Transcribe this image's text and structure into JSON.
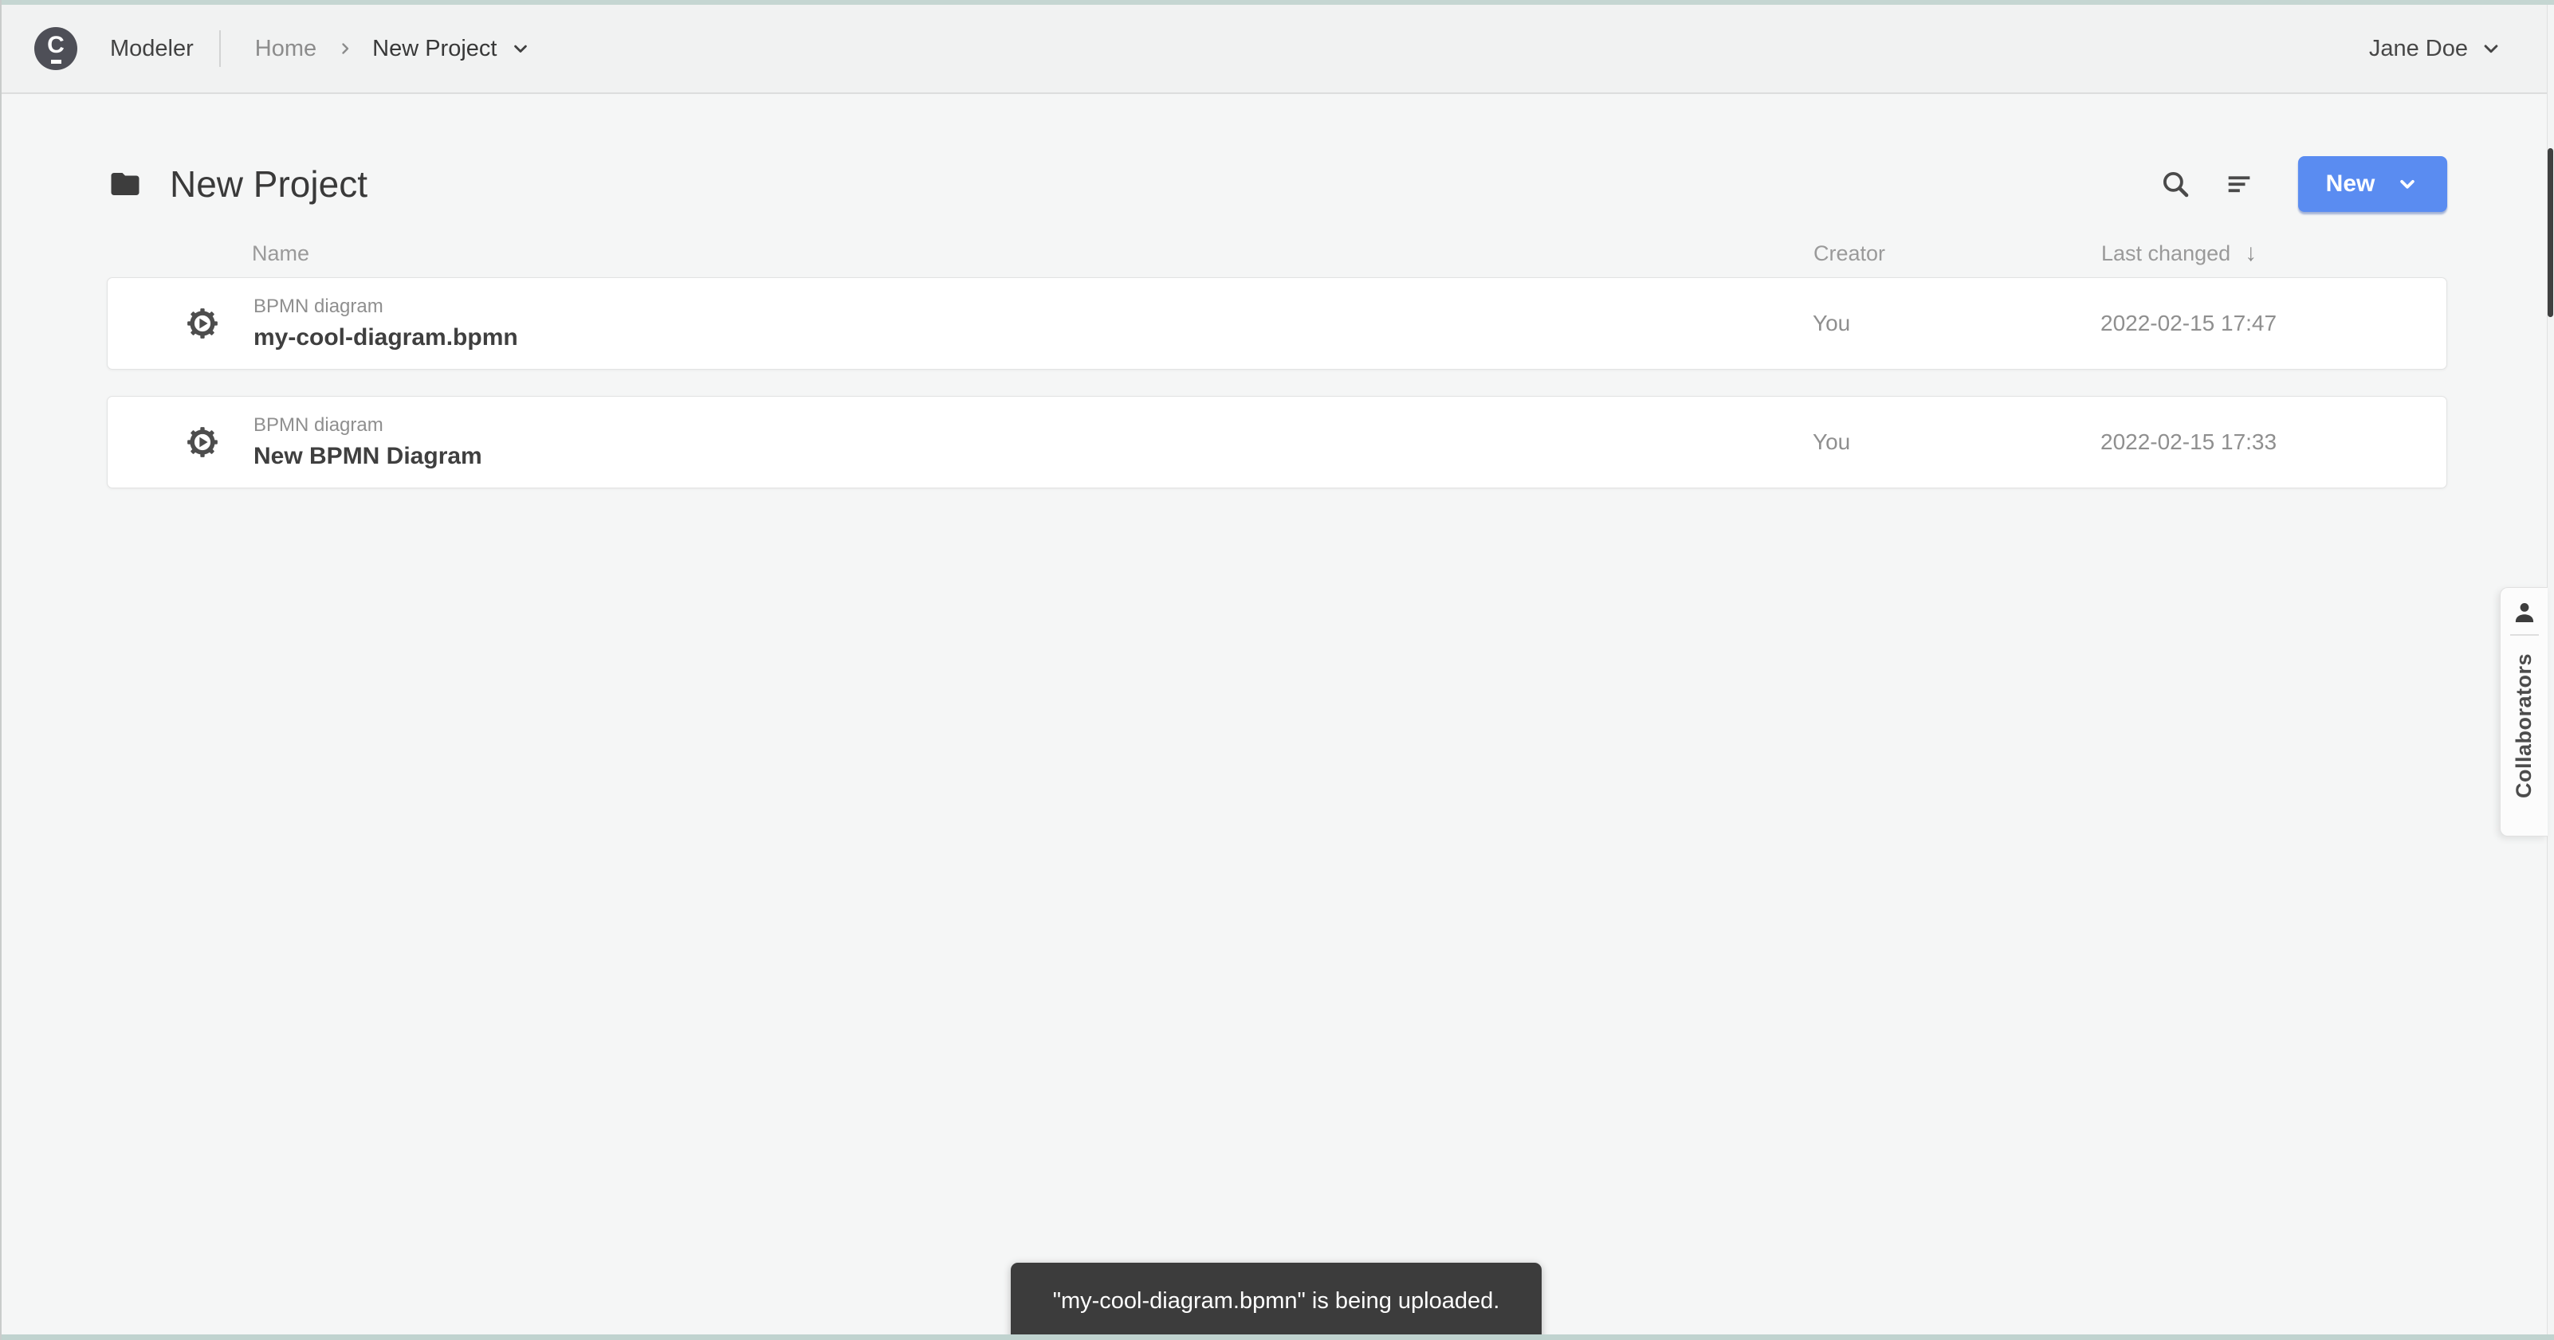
{
  "topbar": {
    "logo_letter": "C",
    "app_name": "Modeler",
    "breadcrumb": {
      "home": "Home",
      "current": "New Project"
    },
    "user_name": "Jane Doe"
  },
  "page": {
    "title": "New Project",
    "new_button_label": "New"
  },
  "table": {
    "headers": {
      "name": "Name",
      "creator": "Creator",
      "last_changed": "Last changed",
      "sort_desc_arrow": "↓"
    },
    "rows": [
      {
        "type_label": "BPMN diagram",
        "name": "my-cool-diagram.bpmn",
        "creator": "You",
        "last_changed": "2022-02-15 17:47"
      },
      {
        "type_label": "BPMN diagram",
        "name": "New BPMN Diagram",
        "creator": "You",
        "last_changed": "2022-02-15 17:33"
      }
    ]
  },
  "collaborators_tab": {
    "label": "Collaborators"
  },
  "toast": {
    "message": "\"my-cool-diagram.bpmn\" is being uploaded."
  },
  "colors": {
    "accent_blue": "#5a8cf1",
    "toast_bg": "#3c3c3c",
    "chrome_strip": "#c5d6d2"
  }
}
